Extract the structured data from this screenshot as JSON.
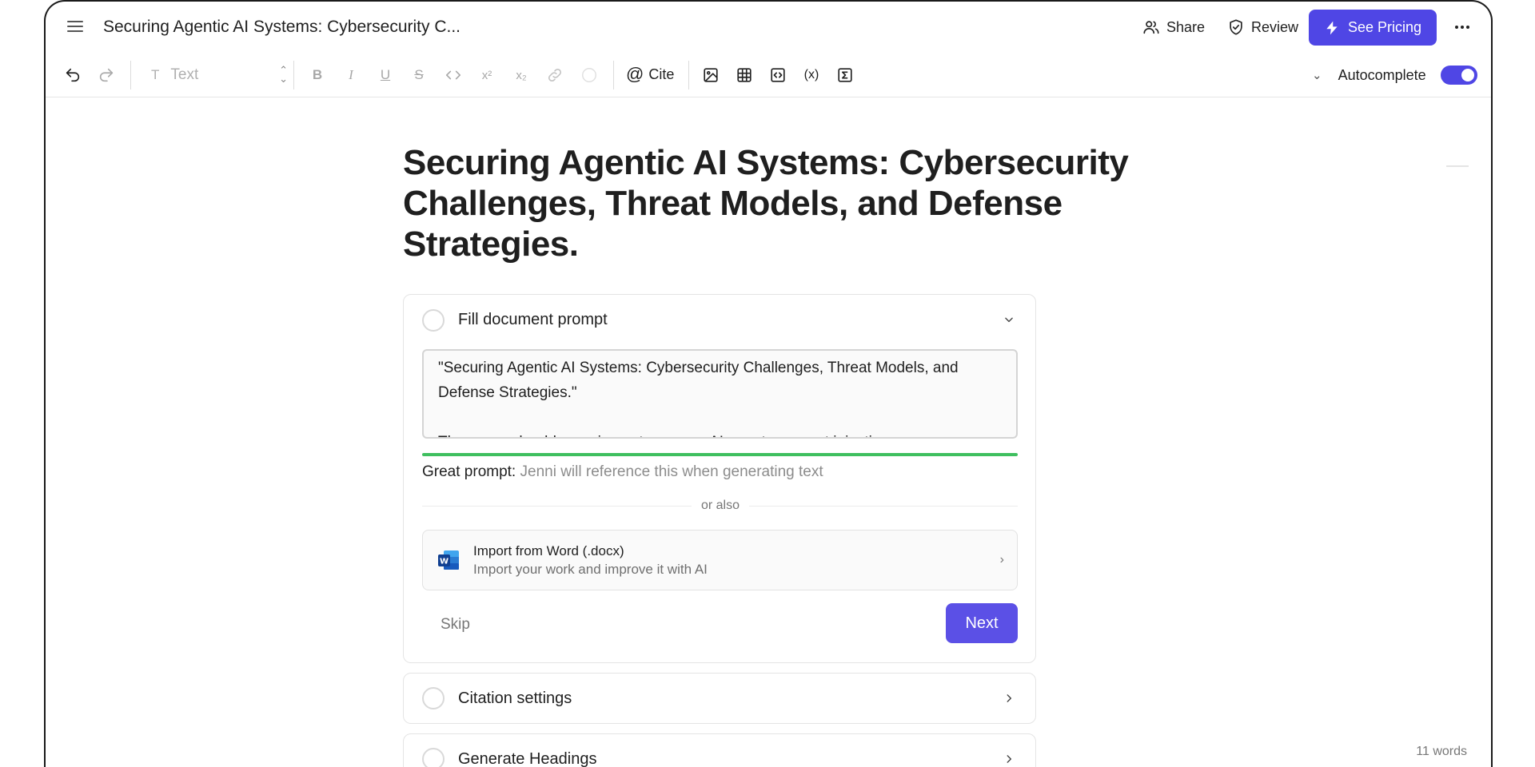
{
  "header": {
    "title": "Securing Agentic AI Systems: Cybersecurity C...",
    "share_label": "Share",
    "review_label": "Review",
    "pricing_label": "See Pricing",
    "accent_color": "#4f46e5"
  },
  "toolbar": {
    "text_style": "Text",
    "cite_label": "Cite",
    "autocomplete_label": "Autocomplete",
    "autocomplete_on": true
  },
  "document": {
    "heading": "Securing Agentic AI Systems: Cybersecurity Challenges, Threat Models, and Defense Strategies.",
    "word_count": "11 words"
  },
  "setup": {
    "prompt_step": {
      "title": "Fill document prompt",
      "prompt_text": "\"Securing Agentic AI Systems: Cybersecurity Challenges, Threat Models, and Defense Strategies.\"\n\nThe paper should examine autonomous AI agents, prompt injection",
      "quality_label": "Great prompt:",
      "quality_hint": "Jenni will reference this when generating text",
      "quality_color": "#3fbf5f",
      "or_also": "or also",
      "import_title": "Import from Word (.docx)",
      "import_subtitle": "Import your work and improve it with AI",
      "skip_label": "Skip",
      "next_label": "Next"
    },
    "citation_step": {
      "title": "Citation settings"
    },
    "headings_step": {
      "title": "Generate Headings"
    }
  }
}
